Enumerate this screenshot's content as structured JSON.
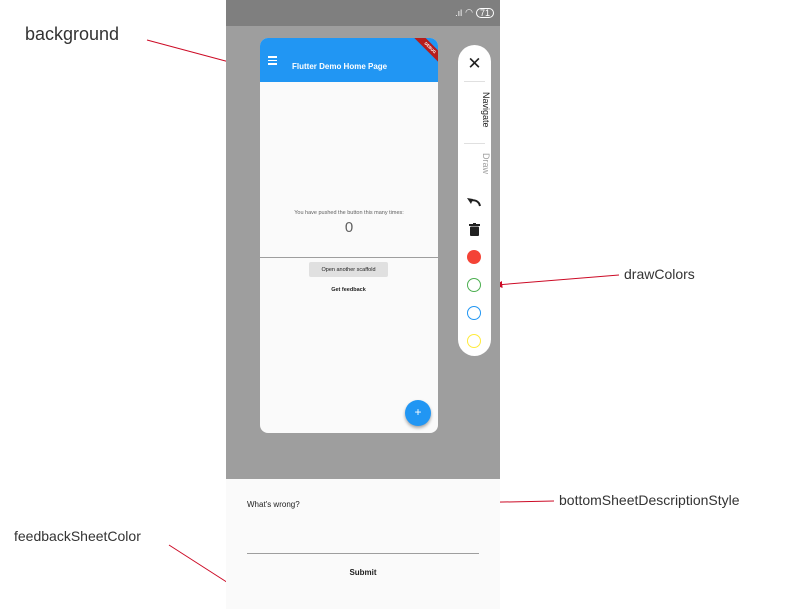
{
  "status_bar": {
    "signal": ".ıl",
    "wifi": "◠",
    "battery": "71"
  },
  "app": {
    "title": "Flutter Demo Home Page",
    "debug_banner": "DEBUG",
    "counter_caption": "You have pushed the button this many times:",
    "counter_value": "0",
    "open_scaffold_label": "Open another scaffold",
    "get_feedback_label": "Get feedback",
    "fab_label": "+"
  },
  "toolbar": {
    "close": "✕",
    "navigate_label": "Navigate",
    "draw_label": "Draw",
    "draw_colors": [
      "#f44336",
      "#4caf50",
      "#2196f3",
      "#ffeb3b"
    ]
  },
  "feedback_sheet": {
    "description": "What's wrong?",
    "submit_label": "Submit"
  },
  "annotations": {
    "background": "background",
    "draw_colors": "drawColors",
    "bottom_sheet_description_style": "bottomSheetDescriptionStyle",
    "feedback_sheet_color": "feedbackSheetColor"
  },
  "colors": {
    "accent": "#2196f3",
    "annotation_arrow": "#cc0a25",
    "phone_background": "#9e9e9e"
  }
}
